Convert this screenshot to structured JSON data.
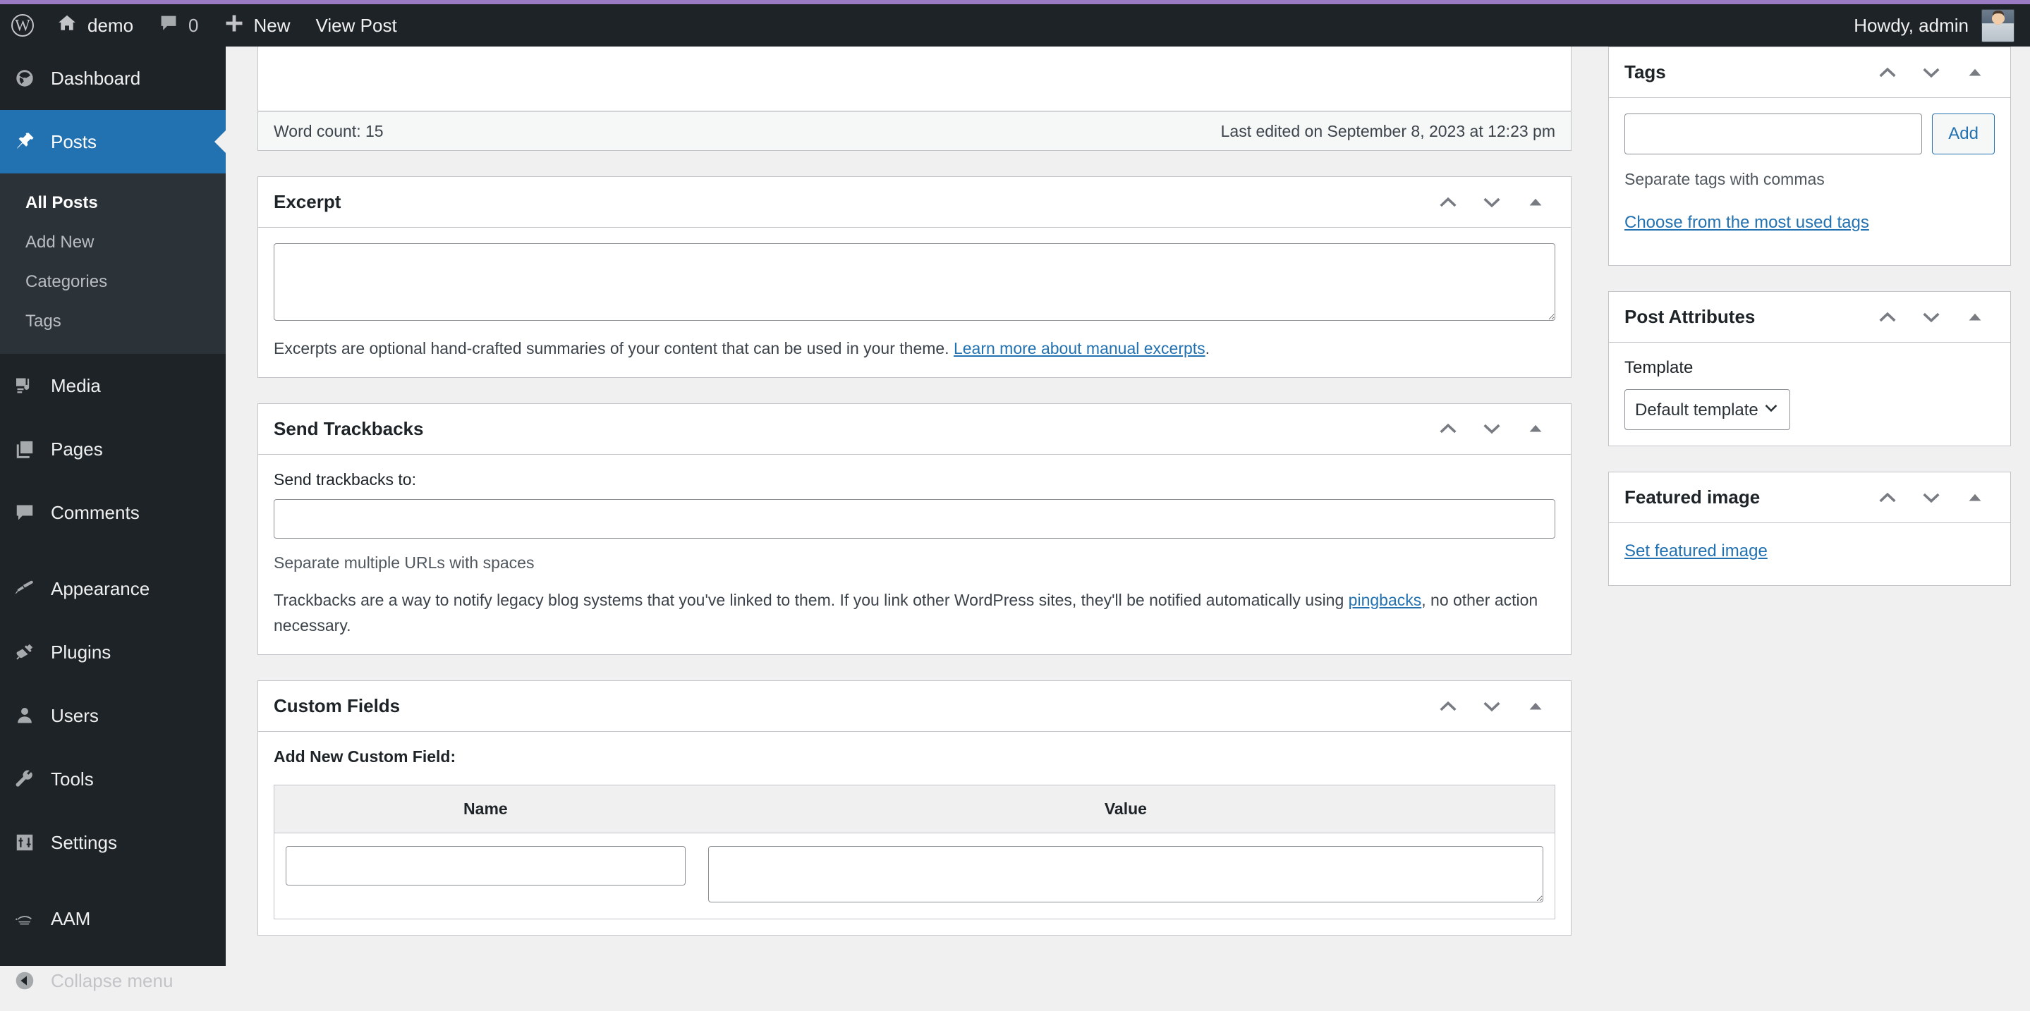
{
  "adminbar": {
    "site_name": "demo",
    "comment_count": "0",
    "new_label": "New",
    "view_post_label": "View Post",
    "howdy": "Howdy, admin",
    "icons": {
      "wordpress": "wordpress-logo-icon",
      "home": "home-icon",
      "comments": "comment-bubble-icon",
      "new": "plus-icon",
      "avatar": "user-avatar"
    }
  },
  "sidebar": {
    "items": [
      {
        "label": "Dashboard",
        "icon": "dashboard-icon",
        "current": false
      },
      {
        "label": "Posts",
        "icon": "pin-icon",
        "current": true
      },
      {
        "label": "Media",
        "icon": "media-icon",
        "current": false
      },
      {
        "label": "Pages",
        "icon": "pages-icon",
        "current": false
      },
      {
        "label": "Comments",
        "icon": "comment-bubble-icon",
        "current": false
      },
      {
        "label": "Appearance",
        "icon": "paintbrush-icon",
        "current": false
      },
      {
        "label": "Plugins",
        "icon": "plug-icon",
        "current": false
      },
      {
        "label": "Users",
        "icon": "user-icon",
        "current": false
      },
      {
        "label": "Tools",
        "icon": "wrench-icon",
        "current": false
      },
      {
        "label": "Settings",
        "icon": "sliders-icon",
        "current": false
      },
      {
        "label": "AAM",
        "icon": "aam-icon",
        "current": false
      }
    ],
    "submenu": [
      {
        "label": "All Posts",
        "current": true
      },
      {
        "label": "Add New",
        "current": false
      },
      {
        "label": "Categories",
        "current": false
      },
      {
        "label": "Tags",
        "current": false
      }
    ],
    "collapse_label": "Collapse menu"
  },
  "editor": {
    "word_count_label": "Word count: 15",
    "last_edited": "Last edited on September 8, 2023 at 12:23 pm"
  },
  "excerpt_box": {
    "title": "Excerpt",
    "value": "",
    "help_prefix": "Excerpts are optional hand-crafted summaries of your content that can be used in your theme. ",
    "help_link": "Learn more about manual excerpts",
    "help_suffix": "."
  },
  "trackbacks_box": {
    "title": "Send Trackbacks",
    "field_label": "Send trackbacks to:",
    "value": "",
    "hint": "Separate multiple URLs with spaces",
    "desc_prefix": "Trackbacks are a way to notify legacy blog systems that you've linked to them. If you link other WordPress sites, they'll be notified automatically using ",
    "desc_link": "pingbacks",
    "desc_suffix": ", no other action necessary."
  },
  "custom_fields_box": {
    "title": "Custom Fields",
    "add_new_label": "Add New Custom Field:",
    "columns": [
      "Name",
      "Value"
    ],
    "row": {
      "name": "",
      "value": ""
    }
  },
  "tags_box": {
    "title": "Tags",
    "input_value": "",
    "add_label": "Add",
    "hint": "Separate tags with commas",
    "most_used_link": "Choose from the most used tags"
  },
  "post_attributes_box": {
    "title": "Post Attributes",
    "template_label": "Template",
    "template_selected": "Default template",
    "template_options": [
      "Default template"
    ]
  },
  "featured_image_box": {
    "title": "Featured image",
    "set_link": "Set featured image"
  },
  "panel_controls": {
    "move_up": "move-up-icon",
    "move_down": "move-down-icon",
    "toggle": "toggle-panel-icon"
  },
  "colors": {
    "admin_bar_bg": "#1d2327",
    "sidebar_bg": "#1d2327",
    "submenu_bg": "#2c3338",
    "accent_blue": "#2271b1",
    "link_blue": "#2271b1",
    "page_bg": "#f0f0f1",
    "border": "#c3c4c7",
    "top_accent": "#9b7bc4"
  }
}
